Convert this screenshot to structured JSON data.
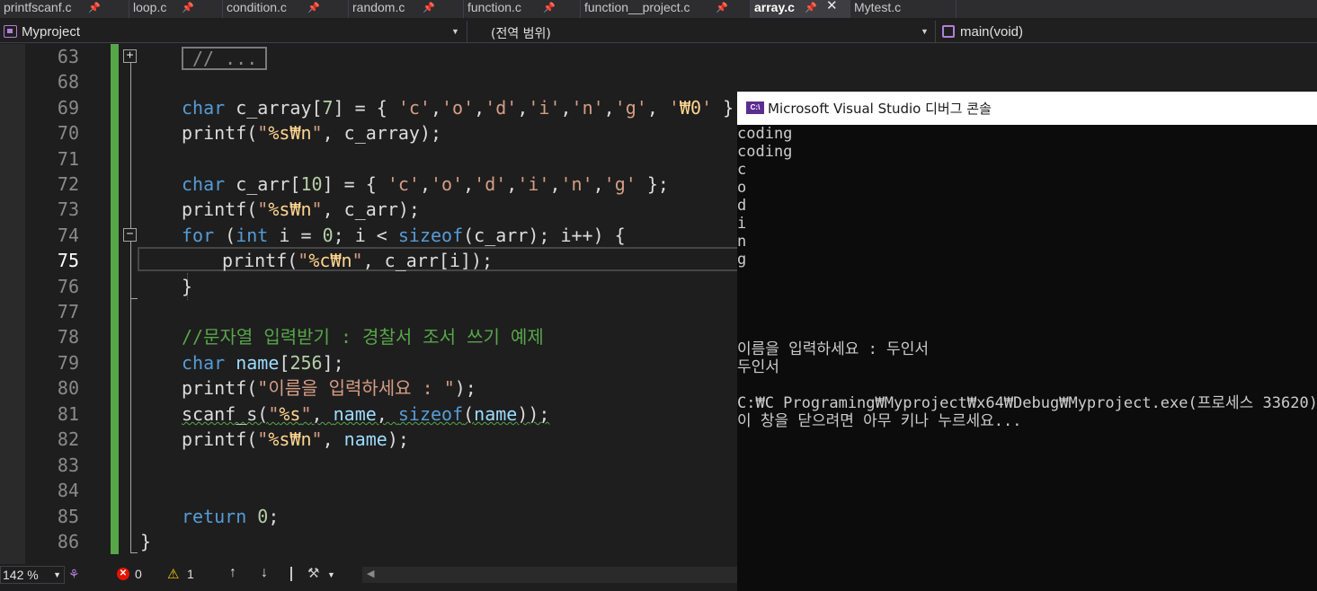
{
  "tabs": [
    {
      "label": "printfscanf.c",
      "active": false
    },
    {
      "label": "loop.c",
      "active": false
    },
    {
      "label": "condition.c",
      "active": false
    },
    {
      "label": "random.c",
      "active": false
    },
    {
      "label": "function.c",
      "active": false
    },
    {
      "label": "function__project.c",
      "active": false
    },
    {
      "label": "array.c",
      "active": true
    },
    {
      "label": "Mytest.c",
      "active": false
    }
  ],
  "navbar": {
    "project": "Myproject",
    "scope": "(전역 범위)",
    "function": "main(void)"
  },
  "editor": {
    "collapsed_placeholder": "// ...",
    "lines": [
      {
        "num": "63",
        "text": ""
      },
      {
        "num": "68",
        "text": ""
      },
      {
        "num": "69",
        "text": "char c_array[7] = { 'c','o','d','i','n','g', '₩0' };"
      },
      {
        "num": "70",
        "text": "printf(\"%s₩n\", c_array);"
      },
      {
        "num": "71",
        "text": ""
      },
      {
        "num": "72",
        "text": "char c_arr[10] = { 'c','o','d','i','n','g' };"
      },
      {
        "num": "73",
        "text": "printf(\"%s₩n\", c_arr);"
      },
      {
        "num": "74",
        "text": "for (int i = 0; i < sizeof(c_arr); i++) {"
      },
      {
        "num": "75",
        "text": "printf(\"%c₩n\", c_arr[i]);"
      },
      {
        "num": "76",
        "text": "}"
      },
      {
        "num": "77",
        "text": ""
      },
      {
        "num": "78",
        "text": "//문자열 입력받기 : 경찰서 조서 쓰기 예제"
      },
      {
        "num": "79",
        "text": "char name[256];"
      },
      {
        "num": "80",
        "text": "printf(\"이름을 입력하세요 : \");"
      },
      {
        "num": "81",
        "text": "scanf_s(\"%s\", name, sizeof(name));"
      },
      {
        "num": "82",
        "text": "printf(\"%s₩n\", name);"
      },
      {
        "num": "83",
        "text": ""
      },
      {
        "num": "84",
        "text": ""
      },
      {
        "num": "85",
        "text": "return 0;"
      },
      {
        "num": "86",
        "text": "}"
      }
    ],
    "current_line": "75"
  },
  "statusbar": {
    "zoom": "142 %",
    "errors": "0",
    "warnings": "1"
  },
  "console": {
    "title": "Microsoft Visual Studio 디버그 콘솔",
    "icon_text": "C:\\",
    "lines": [
      "coding",
      "coding",
      "c",
      "o",
      "d",
      "i",
      "n",
      "g",
      "",
      "",
      "",
      "",
      "이름을 입력하세요 : 두인서",
      "두인서",
      "",
      "C:₩C Programing₩Myproject₩x64₩Debug₩Myproject.exe(프로세스 33620)",
      "이 창을 닫으려면 아무 키나 누르세요..."
    ]
  },
  "colors": {
    "keyword": "#569cd6",
    "string": "#d69d85",
    "comment": "#57a64a",
    "change_bar": "#57a64a"
  }
}
